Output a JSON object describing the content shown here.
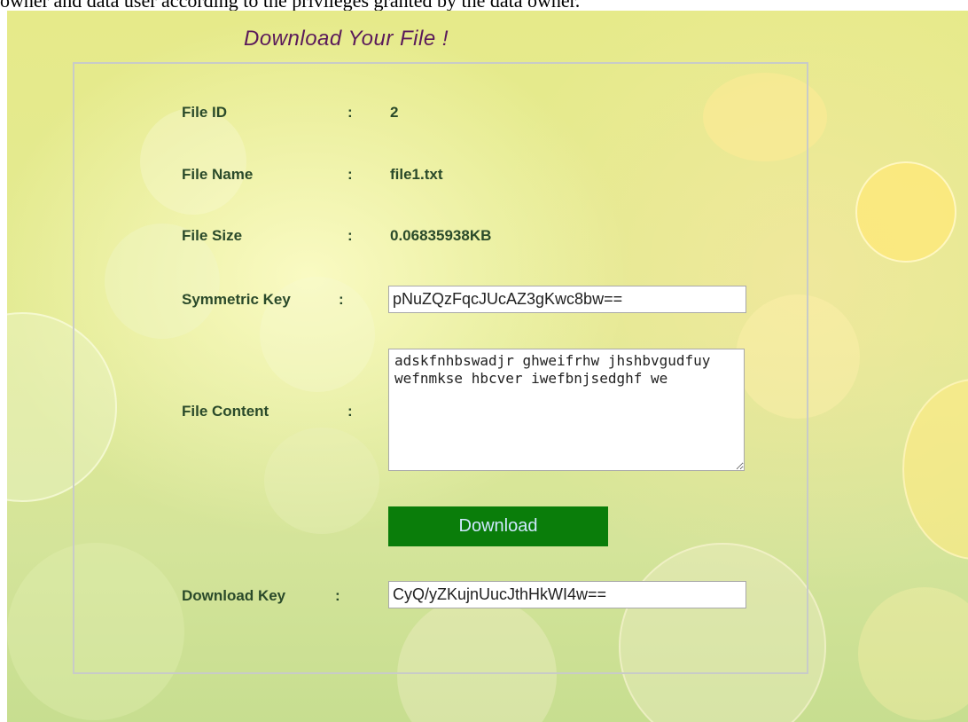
{
  "header": {
    "partial_text": "owner and data user according to the privileges granted by the data owner."
  },
  "page": {
    "title": "Download Your File !"
  },
  "form": {
    "file_id": {
      "label": "File ID",
      "separator": ":",
      "value": "2"
    },
    "file_name": {
      "label": "File Name",
      "separator": ":",
      "value": "file1.txt"
    },
    "file_size": {
      "label": "File Size",
      "separator": ":",
      "value": "0.06835938KB"
    },
    "symmetric_key": {
      "label": "Symmetric Key",
      "separator": ":",
      "value": "pNuZQzFqcJUcAZ3gKwc8bw=="
    },
    "file_content": {
      "label": "File Content",
      "separator": ":",
      "value": "adskfnhbswadjr ghweifrhw jhshbvgudfuy wefnmkse hbcver iwefbnjsedghf we"
    },
    "download_button": {
      "label": "Download"
    },
    "download_key": {
      "label": "Download Key",
      "separator": ":",
      "value": "CyQ/yZKujnUucJthHkWI4w=="
    }
  },
  "colors": {
    "title": "#5a1a5a",
    "label": "#2a4a2a",
    "button_bg": "#0a7d0a",
    "button_text": "#cfe8ff",
    "background": "#e2ea92"
  }
}
